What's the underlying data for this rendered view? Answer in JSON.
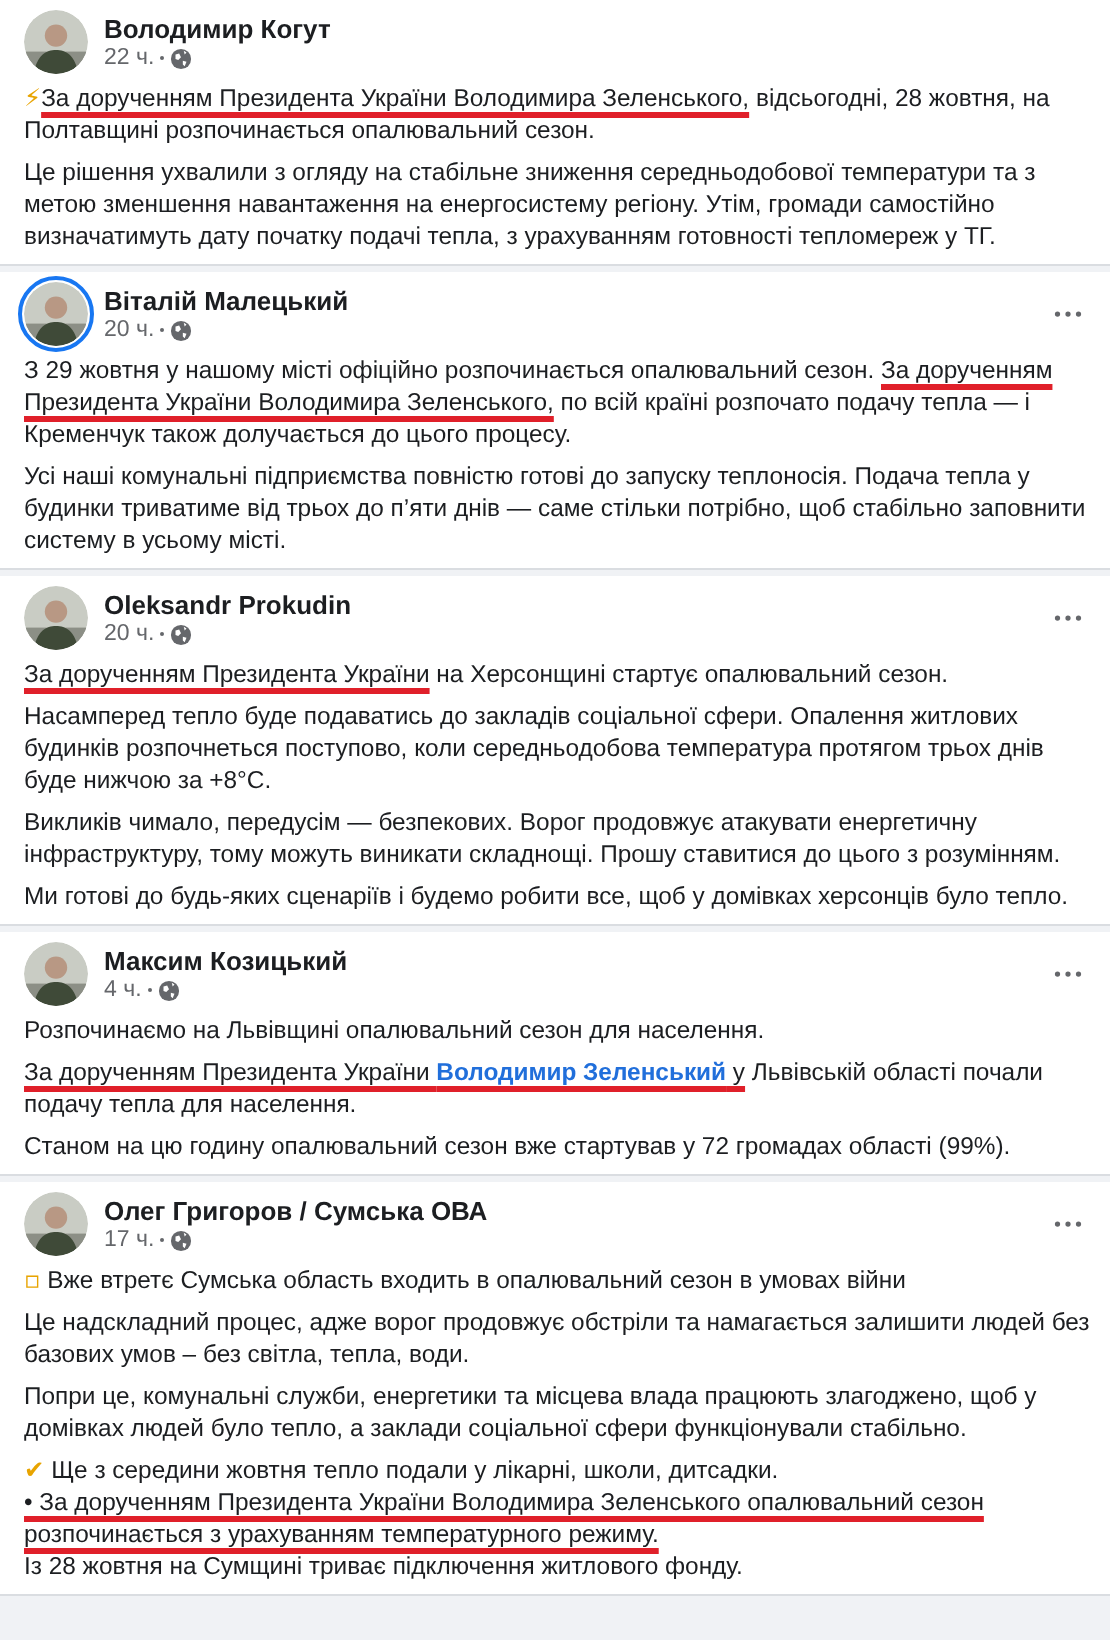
{
  "posts": [
    {
      "author": "Володимир Когут",
      "time": "22 ч.",
      "menu": false,
      "story_ring": false,
      "paragraphs": [
        {
          "segments": [
            {
              "kind": "emoji",
              "text": "⚡"
            },
            {
              "kind": "mark",
              "text": "За дорученням Президента України Володимира Зеленського,"
            },
            {
              "kind": "text",
              "text": " відсьогодні, 28 жовтня, на Полтавщині розпочинається опалювальний сезон."
            }
          ]
        },
        {
          "segments": [
            {
              "kind": "text",
              "text": "Це рішення ухвалили з огляду на стабільне зниження середньодобової температури та з метою зменшення навантаження на енергосистему регіону. Утім, громади самостійно визначатимуть дату початку подачі тепла, з урахуванням готовності тепломереж у ТГ."
            }
          ]
        }
      ]
    },
    {
      "author": "Віталій Малецький",
      "time": "20 ч.",
      "menu": true,
      "story_ring": true,
      "paragraphs": [
        {
          "segments": [
            {
              "kind": "text",
              "text": "З 29 жовтня у нашому місті офіційно розпочинається опалювальний сезон. "
            },
            {
              "kind": "mark",
              "text": "За дорученням Президента України Володимира Зеленського,"
            },
            {
              "kind": "text",
              "text": " по всій країні розпочато подачу тепла — і Кременчук також долучається до цього процесу."
            }
          ]
        },
        {
          "segments": [
            {
              "kind": "text",
              "text": "Усі наші комунальні підприємства повністю готові до запуску теплоносія. Подача тепла у будинки триватиме від трьох до п’яти днів — саме стільки потрібно, щоб стабільно заповнити систему в усьому місті."
            }
          ]
        }
      ]
    },
    {
      "author": "Oleksandr Prokudin",
      "time": "20 ч.",
      "menu": true,
      "story_ring": false,
      "paragraphs": [
        {
          "segments": [
            {
              "kind": "mark",
              "text": "За дорученням Президента України"
            },
            {
              "kind": "text",
              "text": " на Херсонщині стартує опалювальний сезон."
            }
          ]
        },
        {
          "segments": [
            {
              "kind": "text",
              "text": "Насамперед тепло буде подаватись до закладів соціальної сфери. Опалення житлових будинків розпочнеться поступово, коли середньодобова температура протягом трьох днів буде нижчою за +8°C."
            }
          ]
        },
        {
          "segments": [
            {
              "kind": "text",
              "text": "Викликів чимало, передусім — безпекових. Ворог продовжує атакувати енергетичну інфраструктуру, тому можуть виникати складнощі. Прошу ставитися до цього з розумінням."
            }
          ]
        },
        {
          "segments": [
            {
              "kind": "text",
              "text": "Ми готові до будь-яких сценаріїв і будемо робити все, щоб у домівках херсонців було тепло."
            }
          ]
        }
      ]
    },
    {
      "author": "Максим Козицький",
      "time": "4 ч.",
      "menu": true,
      "story_ring": false,
      "paragraphs": [
        {
          "segments": [
            {
              "kind": "text",
              "text": "Розпочинаємо на Львівщині опалювальний сезон для населення."
            }
          ]
        },
        {
          "segments": [
            {
              "kind": "mark",
              "text": "За дорученням Президента України "
            },
            {
              "kind": "link",
              "text": "Володимир Зеленський"
            },
            {
              "kind": "mark",
              "text": " у"
            },
            {
              "kind": "text",
              "text": " Львівській області почали подачу тепла для населення."
            }
          ]
        },
        {
          "segments": [
            {
              "kind": "text",
              "text": "Станом на цю годину опалювальний сезон вже стартував у 72 громадах області (99%)."
            }
          ]
        }
      ]
    },
    {
      "author": "Олег Григоров / Сумська ОВА",
      "time": "17 ч.",
      "menu": true,
      "story_ring": false,
      "paragraphs": [
        {
          "segments": [
            {
              "kind": "emoji",
              "text": "▫"
            },
            {
              "kind": "text",
              "text": " Вже втретє Сумська область входить в опалювальний сезон в умовах війни"
            }
          ]
        },
        {
          "segments": [
            {
              "kind": "text",
              "text": "Це надскладний процес, адже ворог продовжує обстріли та намагається залишити людей без базових умов – без світла, тепла, води."
            }
          ]
        },
        {
          "segments": [
            {
              "kind": "text",
              "text": "Попри це, комунальні служби, енергетики та місцева влада працюють злагоджено, щоб у домівках людей було тепло, а заклади соціальної сфери функціонували стабільно."
            }
          ]
        },
        {
          "segments": [
            {
              "kind": "emoji",
              "text": "✔"
            },
            {
              "kind": "text",
              "text": " Ще з середини жовтня тепло подали у лікарні, школи, дитсадки."
            },
            {
              "kind": "mark",
              "text": "• За дорученням Президента України Володимира Зеленського опалювальний сезон розпочинається з урахуванням температурного режиму.",
              "newline": true
            },
            {
              "kind": "text",
              "text": "Із 28 жовтня на Сумщині триває підключення житлового фонду.",
              "newline": true
            }
          ]
        }
      ]
    }
  ]
}
